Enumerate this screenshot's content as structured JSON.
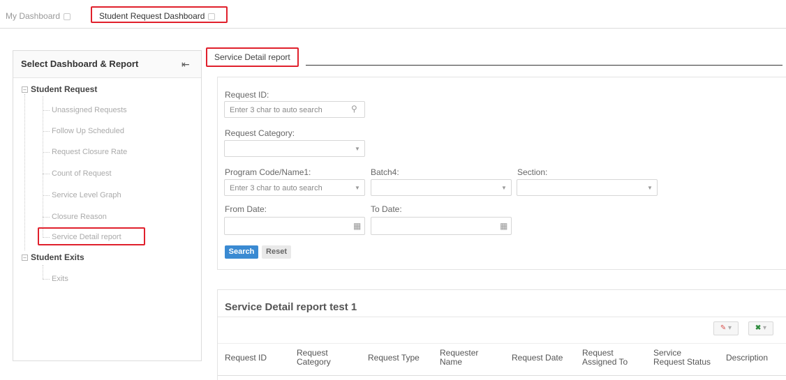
{
  "tabs": [
    {
      "label": "My Dashboard"
    },
    {
      "label": "Student Request Dashboard"
    }
  ],
  "sidebar": {
    "title": "Select Dashboard & Report",
    "groups": [
      {
        "label": "Student Request",
        "items": [
          {
            "label": "Unassigned Requests"
          },
          {
            "label": "Follow Up Scheduled"
          },
          {
            "label": "Request Closure Rate"
          },
          {
            "label": "Count of Request"
          },
          {
            "label": "Service Level Graph"
          },
          {
            "label": "Closure Reason"
          },
          {
            "label": "Service Detail report"
          }
        ]
      },
      {
        "label": "Student Exits",
        "items": [
          {
            "label": "Exits"
          }
        ]
      }
    ]
  },
  "report_tab": {
    "label": "Service Detail report"
  },
  "filters": {
    "request_id": {
      "label": "Request ID:",
      "placeholder": "Enter 3 char to auto search"
    },
    "request_category": {
      "label": "Request Category:"
    },
    "program": {
      "label": "Program Code/Name1:",
      "placeholder": "Enter 3 char to auto search"
    },
    "batch": {
      "label": "Batch4:"
    },
    "section": {
      "label": "Section:"
    },
    "from_date": {
      "label": "From Date:"
    },
    "to_date": {
      "label": "To Date:"
    },
    "search_label": "Search",
    "reset_label": "Reset"
  },
  "results": {
    "title": "Service Detail report test 1",
    "columns": [
      {
        "line1": "Request ID",
        "line2": ""
      },
      {
        "line1": "Request",
        "line2": "Category"
      },
      {
        "line1": "Request Type",
        "line2": ""
      },
      {
        "line1": "Requester",
        "line2": "Name"
      },
      {
        "line1": "Request Date",
        "line2": ""
      },
      {
        "line1": "Request",
        "line2": "Assigned To"
      },
      {
        "line1": "Service",
        "line2": "Request Status"
      },
      {
        "line1": "Description",
        "line2": ""
      }
    ]
  },
  "colors": {
    "accent": "#3a8ad2",
    "highlight": "#e0202c",
    "pdf": "#d9534f",
    "excel": "#2e8b3d"
  }
}
